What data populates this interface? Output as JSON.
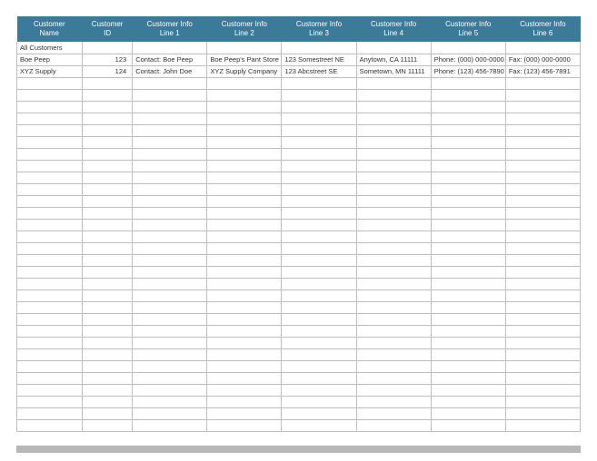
{
  "columns": [
    {
      "line1": "Customer",
      "line2": "Name"
    },
    {
      "line1": "Customer",
      "line2": "ID"
    },
    {
      "line1": "Customer Info",
      "line2": "Line 1"
    },
    {
      "line1": "Customer Info",
      "line2": "Line 2"
    },
    {
      "line1": "Customer Info",
      "line2": "Line 3"
    },
    {
      "line1": "Customer Info",
      "line2": "Line 4"
    },
    {
      "line1": "Customer Info",
      "line2": "Line 5"
    },
    {
      "line1": "Customer Info",
      "line2": "Line 6"
    }
  ],
  "rows": [
    {
      "name": "All Customers",
      "id": "",
      "l1": "",
      "l2": "",
      "l3": "",
      "l4": "",
      "l5": "",
      "l6": ""
    },
    {
      "name": "Boe Peep",
      "id": "123",
      "l1": "Contact: Boe Peep",
      "l2": "Boe Peep's Pant Store",
      "l3": "123 Somestreet NE",
      "l4": "Anytown, CA 11111",
      "l5": "Phone: (000) 000-0000",
      "l6": "Fax: (000) 000-0000"
    },
    {
      "name": "XYZ Supply",
      "id": "124",
      "l1": "Contact: John Doe",
      "l2": "XYZ Supply Company",
      "l3": "123 Abcstreet SE",
      "l4": "Sometown, MN 11111",
      "l5": "Phone: (123) 456-7890",
      "l6": "Fax: (123) 456-7891"
    }
  ],
  "emptyRowCount": 30
}
